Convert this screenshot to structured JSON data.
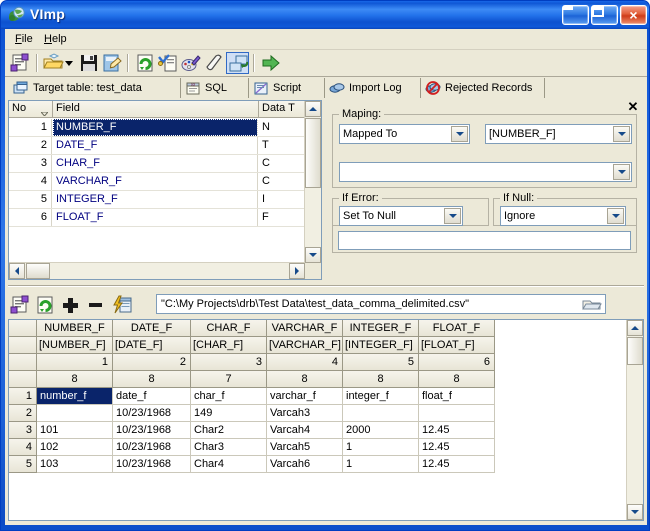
{
  "window": {
    "title": "VImp",
    "icon": "app-globe-icon",
    "buttons": {
      "minimize": "_",
      "maximize": "□",
      "close": "×"
    }
  },
  "menu": {
    "items": [
      {
        "label": "File",
        "accel": "F"
      },
      {
        "label": "Help",
        "accel": "H"
      }
    ]
  },
  "toolbar": {
    "buttons": [
      {
        "name": "properties-icon",
        "tip": "Properties"
      },
      {
        "name": "open-folder-icon",
        "tip": "Open"
      },
      {
        "name": "dropdown-arrow-icon",
        "tip": "Open recent"
      },
      {
        "name": "save-disk-icon",
        "tip": "Save"
      },
      {
        "name": "save-as-icon",
        "tip": "Save As"
      },
      {
        "name": "refresh-page-icon",
        "tip": "Refresh"
      },
      {
        "name": "check-page-icon",
        "tip": "Validate"
      },
      {
        "name": "palette-icon",
        "tip": "Options"
      },
      {
        "name": "eraser-icon",
        "tip": "Clear"
      },
      {
        "name": "map-fields-icon",
        "tip": "Map fields"
      },
      {
        "name": "run-arrow-icon",
        "tip": "Run import"
      }
    ]
  },
  "tabs": [
    {
      "label": "Target table: test_data",
      "icon": "table-icon",
      "active": true
    },
    {
      "label": "SQL",
      "icon": "sql-icon",
      "active": false
    },
    {
      "label": "Script",
      "icon": "script-icon",
      "active": false
    },
    {
      "label": "Import Log",
      "icon": "log-icon",
      "active": false
    },
    {
      "label": "Rejected Records",
      "icon": "rejected-icon",
      "active": false
    }
  ],
  "field_grid": {
    "columns": [
      {
        "label": "No",
        "sorted": true
      },
      {
        "label": "Field"
      },
      {
        "label": "Data T"
      }
    ],
    "rows": [
      {
        "no": "1",
        "field": "NUMBER_F",
        "type": "N",
        "selected": true
      },
      {
        "no": "2",
        "field": "DATE_F",
        "type": "T",
        "selected": false
      },
      {
        "no": "3",
        "field": "CHAR_F",
        "type": "C",
        "selected": false
      },
      {
        "no": "4",
        "field": "VARCHAR_F",
        "type": "C",
        "selected": false
      },
      {
        "no": "5",
        "field": "INTEGER_F",
        "type": "I",
        "selected": false
      },
      {
        "no": "6",
        "field": "FLOAT_F",
        "type": "F",
        "selected": false
      }
    ]
  },
  "mapping_panel": {
    "close_label": "✕",
    "mapping_group": {
      "title": "Maping:",
      "mode_value": "Mapped To",
      "source_value": "[NUMBER_F]",
      "expression_value": ""
    },
    "if_error_group": {
      "title": "If Error:",
      "value": "Set To Null"
    },
    "if_null_group": {
      "title": "If Null:",
      "value": "Ignore"
    },
    "bottom_value": ""
  },
  "lower_toolbar": {
    "buttons": [
      {
        "name": "properties-icon",
        "tip": "Properties"
      },
      {
        "name": "refresh-icon",
        "tip": "Refresh"
      },
      {
        "name": "add-icon",
        "tip": "Add"
      },
      {
        "name": "remove-icon",
        "tip": "Remove"
      },
      {
        "name": "quick-grid-icon",
        "tip": "Auto fill"
      }
    ],
    "path_value": "\"C:\\My Projects\\drb\\Test Data\\test_data_comma_delimited.csv\"",
    "browse_icon": "open-folder-icon"
  },
  "data_grid": {
    "header_rows": [
      {
        "name": "field-names",
        "cells": [
          "NUMBER_F",
          "DATE_F",
          "CHAR_F",
          "VARCHAR_F",
          "INTEGER_F",
          "FLOAT_F"
        ],
        "align": "center"
      },
      {
        "name": "bracket-names",
        "cells": [
          "[NUMBER_F]",
          "[DATE_F]",
          "[CHAR_F]",
          "[VARCHAR_F]",
          "[INTEGER_F]",
          "[FLOAT_F]"
        ],
        "align": "left"
      },
      {
        "name": "column-index",
        "cells": [
          "1",
          "2",
          "3",
          "4",
          "5",
          "6"
        ],
        "align": "right"
      },
      {
        "name": "column-width",
        "cells": [
          "8",
          "8",
          "7",
          "8",
          "8",
          "8"
        ],
        "align": "center"
      }
    ],
    "rows": [
      {
        "no": "1",
        "cells": [
          "number_f",
          "date_f",
          "char_f",
          "varchar_f",
          "integer_f",
          "float_f"
        ],
        "selected_cell": 0
      },
      {
        "no": "2",
        "cells": [
          "",
          "10/23/1968",
          "149",
          "Varcah3",
          "",
          ""
        ],
        "selected_cell": -1
      },
      {
        "no": "3",
        "cells": [
          "101",
          "10/23/1968",
          "Char2",
          "Varcah4",
          "2000",
          "12.45"
        ],
        "selected_cell": -1
      },
      {
        "no": "4",
        "cells": [
          "102",
          "10/23/1968",
          "Char3",
          "Varcah5",
          "1",
          "12.45"
        ],
        "selected_cell": -1
      },
      {
        "no": "5",
        "cells": [
          "103",
          "10/23/1968",
          "Char4",
          "Varcah6",
          "1",
          "12.45"
        ],
        "selected_cell": -1
      }
    ]
  },
  "colors": {
    "title_blue": "#0a4ecb",
    "face": "#ece9d8",
    "selection": "#0a246a",
    "field_text": "#000080"
  }
}
